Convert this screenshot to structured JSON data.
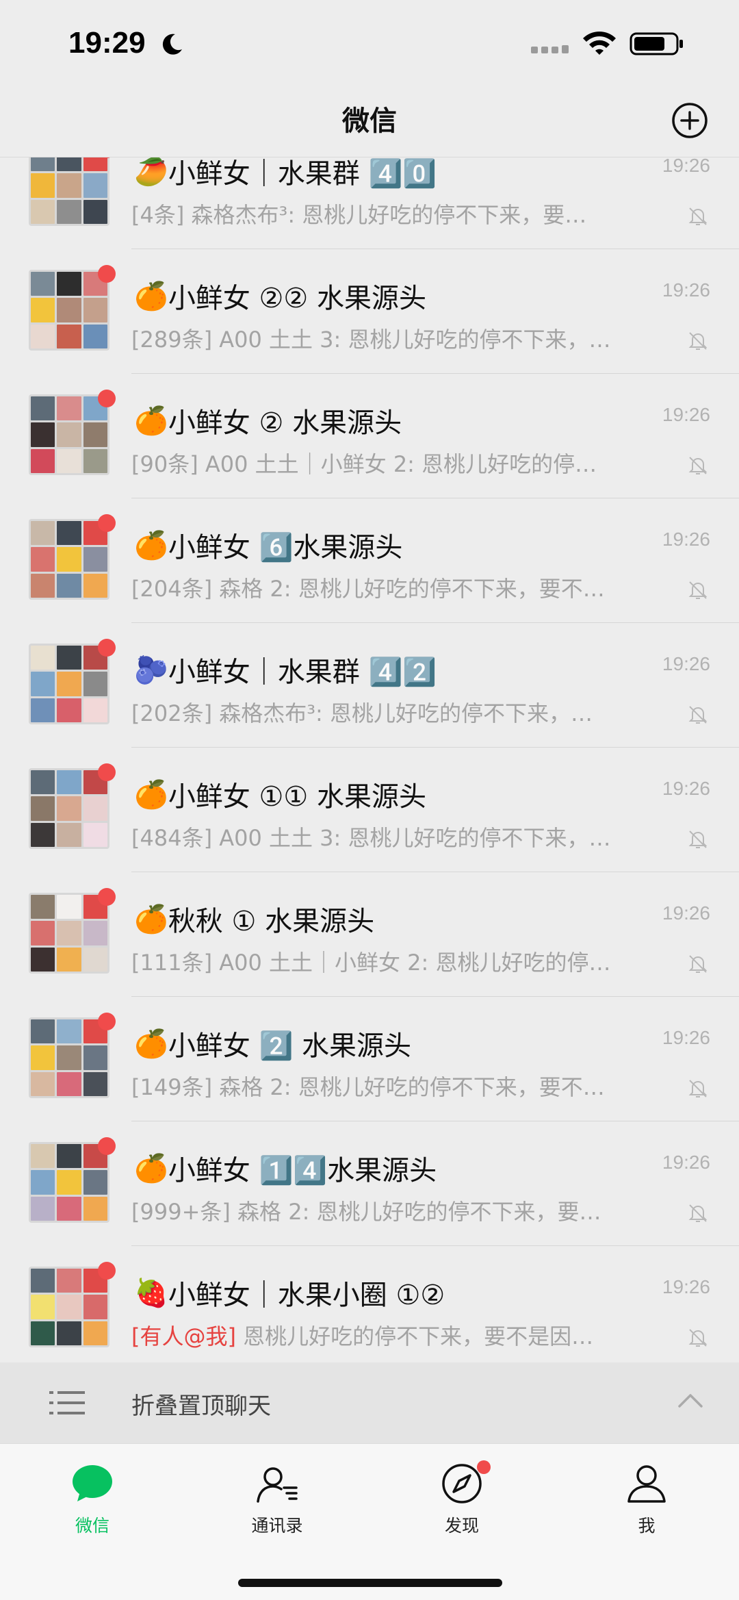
{
  "status_bar": {
    "time": "19:29"
  },
  "nav": {
    "title": "微信"
  },
  "chats": [
    {
      "emoji": "🥭",
      "name": "小鲜女｜水果群 4️⃣0️⃣",
      "time": "19:26",
      "mention": "",
      "preview": "[4条] 森格杰布³: 恩桃儿好吃的停不下来，要…",
      "avatar_colors": [
        "#6f7f8c",
        "#4a5560",
        "#e04a48",
        "#f0b73a",
        "#c9a58a",
        "#8aa9c7",
        "#d9c8b0",
        "#8e8e8e",
        "#3e4650"
      ]
    },
    {
      "emoji": "🍊",
      "name": "小鲜女 ②② 水果源头",
      "time": "19:26",
      "mention": "",
      "preview": "[289条] A00 土土 3: 恩桃儿好吃的停不下来，…",
      "avatar_colors": [
        "#7a8a96",
        "#2d2d2d",
        "#d87a7a",
        "#f2c43c",
        "#b08a78",
        "#c4a08c",
        "#e8d8d0",
        "#c8604e",
        "#6a8fb8"
      ]
    },
    {
      "emoji": "🍊",
      "name": "小鲜女 ② 水果源头",
      "time": "19:26",
      "mention": "",
      "preview": "[90条] A00 土土｜小鲜女 2: 恩桃儿好吃的停…",
      "avatar_colors": [
        "#5d6b77",
        "#d98c8c",
        "#7fa6c9",
        "#3a3030",
        "#c9b5a5",
        "#8f7c6c",
        "#d24a5a",
        "#e8e0d8",
        "#9a9a8a"
      ]
    },
    {
      "emoji": "🍊",
      "name": "小鲜女 6️⃣水果源头",
      "time": "19:26",
      "mention": "",
      "preview": "[204条] 森格 2: 恩桃儿好吃的停不下来，要不…",
      "avatar_colors": [
        "#c8b8a8",
        "#3f4852",
        "#e04a48",
        "#d9736e",
        "#f2c43c",
        "#8a8fa0",
        "#c9846e",
        "#6f8aa4",
        "#f0a850"
      ]
    },
    {
      "emoji": "🫐",
      "name": "小鲜女｜水果群 4️⃣2️⃣",
      "time": "19:26",
      "mention": "",
      "preview": "[202条] 森格杰布³: 恩桃儿好吃的停不下来，…",
      "avatar_colors": [
        "#e8e0d0",
        "#3c4248",
        "#b84a48",
        "#7fa6c9",
        "#f0a850",
        "#8a8a8a",
        "#6f90b8",
        "#d8606a",
        "#f2d8d8"
      ]
    },
    {
      "emoji": "🍊",
      "name": "小鲜女 ①① 水果源头",
      "time": "19:26",
      "mention": "",
      "preview": "[484条] A00 土土 3: 恩桃儿好吃的停不下来，…",
      "avatar_colors": [
        "#5d6b77",
        "#7fa6c9",
        "#c24848",
        "#8a7868",
        "#d8a890",
        "#e8d0d0",
        "#3c3838",
        "#c8b0a0",
        "#f0dce4"
      ]
    },
    {
      "emoji": "🍊",
      "name": "秋秋 ① 水果源头",
      "time": "19:26",
      "mention": "",
      "preview": "[111条] A00 土土｜小鲜女 2: 恩桃儿好吃的停…",
      "avatar_colors": [
        "#8a7c6c",
        "#f2f0ee",
        "#e04a48",
        "#d8706e",
        "#d8c0b0",
        "#c8b8c8",
        "#3c3030",
        "#f0b050",
        "#e0d8d0"
      ]
    },
    {
      "emoji": "🍊",
      "name": "小鲜女 2️⃣ 水果源头",
      "time": "19:26",
      "mention": "",
      "preview": "[149条] 森格 2: 恩桃儿好吃的停不下来，要不…",
      "avatar_colors": [
        "#5d6b77",
        "#8fb0cc",
        "#e04a48",
        "#f2c43c",
        "#9a8878",
        "#6a7684",
        "#d8b8a0",
        "#d86a7a",
        "#4a5058"
      ]
    },
    {
      "emoji": "🍊",
      "name": "小鲜女 1️⃣4️⃣水果源头",
      "time": "19:26",
      "mention": "",
      "preview": "[999+条] 森格 2: 恩桃儿好吃的停不下来，要…",
      "avatar_colors": [
        "#d8c8b0",
        "#3c4248",
        "#c84a48",
        "#7fa6c9",
        "#f2c43c",
        "#6a7684",
        "#b8b0c8",
        "#d86a7a",
        "#f0a850"
      ]
    },
    {
      "emoji": "🍓",
      "name": "小鲜女｜水果小圈 ①②",
      "time": "19:26",
      "mention": "[有人@我]",
      "preview": " 恩桃儿好吃的停不下来，要不是因…",
      "avatar_colors": [
        "#5d6b77",
        "#d87a7a",
        "#e04a48",
        "#f2e070",
        "#e8c8c0",
        "#d86a6a",
        "#2f5a4a",
        "#3c4248",
        "#f0a850"
      ]
    }
  ],
  "fold": {
    "label": "折叠置顶聊天"
  },
  "tabs": [
    {
      "label": "微信",
      "icon": "chat-bubble-icon",
      "active": true
    },
    {
      "label": "通讯录",
      "icon": "contacts-icon",
      "active": false
    },
    {
      "label": "发现",
      "icon": "compass-icon",
      "active": false
    },
    {
      "label": "我",
      "icon": "person-icon",
      "active": false
    }
  ],
  "colors": {
    "accent_green": "#07c160",
    "badge_red": "#f04b4b",
    "mention_red": "#e64340"
  }
}
